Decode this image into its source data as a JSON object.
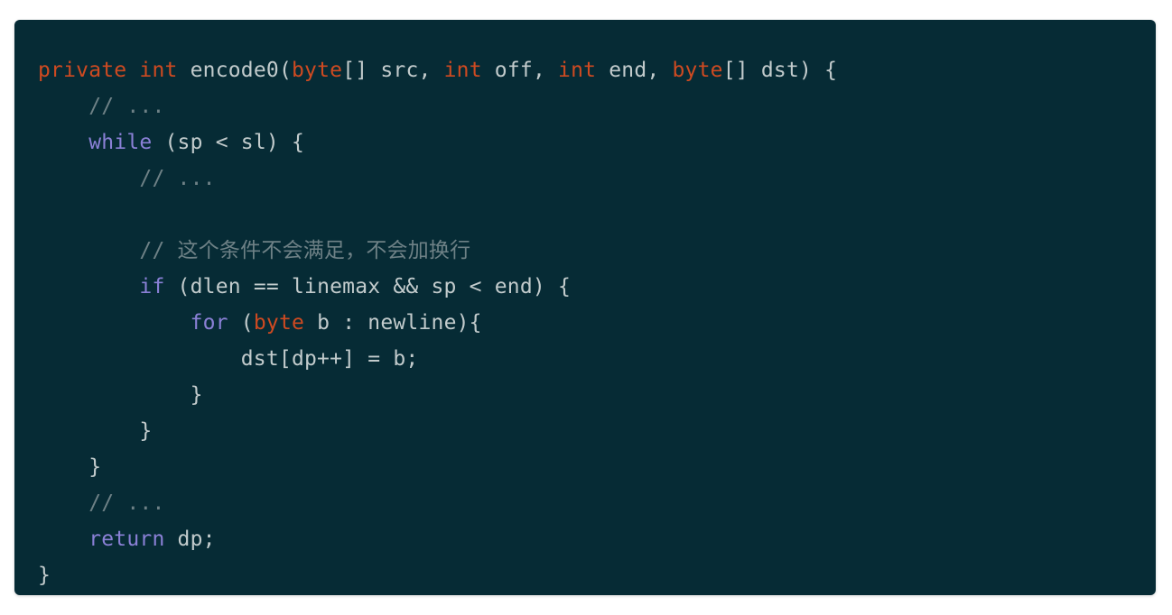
{
  "theme": {
    "page_background": "#ffffff",
    "panel_background": "#062b35",
    "default_text": "#c2cbcc",
    "type_keyword": "#ce4a21",
    "control_keyword": "#8a80d6",
    "comment": "#6e8186"
  },
  "code": {
    "language": "java",
    "lines": [
      {
        "index": 1,
        "text": "private int encode0(byte[] src, int off, int end, byte[] dst) {",
        "tokens": [
          {
            "t": "private",
            "k": "type"
          },
          {
            "t": " ",
            "k": "default"
          },
          {
            "t": "int",
            "k": "type"
          },
          {
            "t": " encode0(",
            "k": "default"
          },
          {
            "t": "byte",
            "k": "type"
          },
          {
            "t": "[] src, ",
            "k": "default"
          },
          {
            "t": "int",
            "k": "type"
          },
          {
            "t": " off, ",
            "k": "default"
          },
          {
            "t": "int",
            "k": "type"
          },
          {
            "t": " end, ",
            "k": "default"
          },
          {
            "t": "byte",
            "k": "type"
          },
          {
            "t": "[] dst) {",
            "k": "default"
          }
        ]
      },
      {
        "index": 2,
        "text": "    // ...",
        "tokens": [
          {
            "t": "    ",
            "k": "default"
          },
          {
            "t": "// ...",
            "k": "comment"
          }
        ]
      },
      {
        "index": 3,
        "text": "    while (sp < sl) {",
        "tokens": [
          {
            "t": "    ",
            "k": "default"
          },
          {
            "t": "while",
            "k": "keyword"
          },
          {
            "t": " (sp < sl) {",
            "k": "default"
          }
        ]
      },
      {
        "index": 4,
        "text": "        // ...",
        "tokens": [
          {
            "t": "        ",
            "k": "default"
          },
          {
            "t": "// ...",
            "k": "comment"
          }
        ]
      },
      {
        "index": 5,
        "text": "",
        "tokens": [
          {
            "t": " ",
            "k": "default"
          }
        ]
      },
      {
        "index": 6,
        "text": "        // 这个条件不会满足，不会加换行",
        "tokens": [
          {
            "t": "        ",
            "k": "default"
          },
          {
            "t": "// 这个条件不会满足，不会加换行",
            "k": "comment"
          }
        ]
      },
      {
        "index": 7,
        "text": "        if (dlen == linemax && sp < end) {",
        "tokens": [
          {
            "t": "        ",
            "k": "default"
          },
          {
            "t": "if",
            "k": "keyword"
          },
          {
            "t": " (dlen == linemax && sp < end) {",
            "k": "default"
          }
        ]
      },
      {
        "index": 8,
        "text": "            for (byte b : newline){",
        "tokens": [
          {
            "t": "            ",
            "k": "default"
          },
          {
            "t": "for",
            "k": "keyword"
          },
          {
            "t": " (",
            "k": "default"
          },
          {
            "t": "byte",
            "k": "type"
          },
          {
            "t": " b : newline){",
            "k": "default"
          }
        ]
      },
      {
        "index": 9,
        "text": "                dst[dp++] = b;",
        "tokens": [
          {
            "t": "                dst[dp++] = b;",
            "k": "default"
          }
        ]
      },
      {
        "index": 10,
        "text": "            }",
        "tokens": [
          {
            "t": "            }",
            "k": "default"
          }
        ]
      },
      {
        "index": 11,
        "text": "        }",
        "tokens": [
          {
            "t": "        }",
            "k": "default"
          }
        ]
      },
      {
        "index": 12,
        "text": "    }",
        "tokens": [
          {
            "t": "    }",
            "k": "default"
          }
        ]
      },
      {
        "index": 13,
        "text": "    // ...",
        "tokens": [
          {
            "t": "    ",
            "k": "default"
          },
          {
            "t": "// ...",
            "k": "comment"
          }
        ]
      },
      {
        "index": 14,
        "text": "    return dp;",
        "tokens": [
          {
            "t": "    ",
            "k": "default"
          },
          {
            "t": "return",
            "k": "keyword"
          },
          {
            "t": " dp;",
            "k": "default"
          }
        ]
      },
      {
        "index": 15,
        "text": "}",
        "tokens": [
          {
            "t": "}",
            "k": "default"
          }
        ]
      }
    ]
  }
}
